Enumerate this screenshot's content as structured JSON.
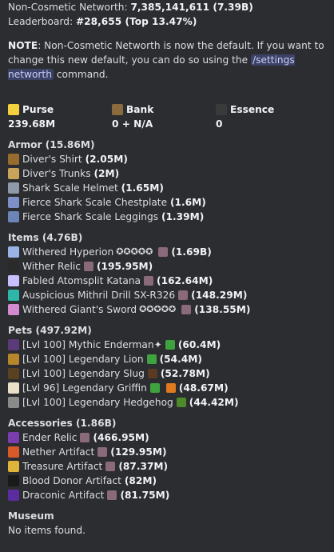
{
  "header": {
    "non_cosmetic_label": "Non-Cosmetic Networth:",
    "non_cosmetic_value": "7,385,141,611 (7.39B)",
    "leaderboard_label": "Leaderboard:",
    "leaderboard_value": "#28,655 (Top 13.47%)"
  },
  "note": {
    "label": "NOTE",
    "text1": ": Non-Cosmetic Networth is now the default. If you want to change this new default, you can do so using the ",
    "command": "/settings networth",
    "text2": " command."
  },
  "summary": [
    {
      "label": "Purse",
      "value": "239.68M",
      "icon": "gold-ingot-icon",
      "color": "#f4d03f"
    },
    {
      "label": "Bank",
      "value": "0 + N/A",
      "icon": "chest-icon",
      "color": "#8b6a3e"
    },
    {
      "label": "Essence",
      "value": "0",
      "icon": "ender-eye-icon",
      "color": "#3a3a3a"
    }
  ],
  "armor": {
    "title": "Armor (15.86M)",
    "items": [
      {
        "name": "Diver's Shirt",
        "value": "(2.05M)",
        "color": "#9a6b2f"
      },
      {
        "name": "Diver's Trunks",
        "value": "(2M)",
        "color": "#c9a35a"
      },
      {
        "name": "Shark Scale Helmet",
        "value": "(1.65M)",
        "color": "#8f9aa8"
      },
      {
        "name": "Fierce Shark Scale Chestplate",
        "value": "(1.6M)",
        "color": "#7d90c8"
      },
      {
        "name": "Fierce Shark Scale Leggings",
        "value": "(1.39M)",
        "color": "#6d84b8"
      }
    ]
  },
  "items_section": {
    "title": "Items (4.76B)",
    "items": [
      {
        "name": "Withered Hyperion",
        "stars": "✪✪✪✪✪",
        "value": "(1.69B)",
        "color": "#9ab3e6",
        "extra": true
      },
      {
        "name": "Wither Relic",
        "stars": "",
        "value": "(195.95M)",
        "color": "#2a2a2a",
        "extra": true
      },
      {
        "name": "Fabled Atomsplit Katana",
        "stars": "",
        "value": "(162.64M)",
        "color": "#c7c0ff",
        "extra": true
      },
      {
        "name": "Auspicious Mithril Drill SX-R326",
        "stars": "",
        "value": "(148.29M)",
        "color": "#2fb6a9",
        "extra": true
      },
      {
        "name": "Withered Giant's Sword",
        "stars": "✪✪✪✪✪",
        "value": "(138.55M)",
        "color": "#d48ad0",
        "extra": true
      }
    ]
  },
  "pets": {
    "title": "Pets (497.92M)",
    "items": [
      {
        "name": "[Lvl 100] Mythic Enderman",
        "suffix": "✦",
        "value": "(60.4M)",
        "color": "#5a3a78",
        "items": [
          "#3ea33e"
        ]
      },
      {
        "name": "[Lvl 100] Legendary Lion",
        "suffix": "",
        "value": "(54.4M)",
        "color": "#b9862c",
        "items": [
          "#3ea33e"
        ]
      },
      {
        "name": "[Lvl 100] Legendary Slug",
        "suffix": "",
        "value": "(52.78M)",
        "color": "#5a4220",
        "items": [
          "#5a3a22"
        ]
      },
      {
        "name": "[Lvl 96] Legendary Griffin",
        "suffix": "",
        "value": "(48.67M)",
        "color": "#e8e0c8",
        "items": [
          "#3ea33e",
          "#e07a1e"
        ]
      },
      {
        "name": "[Lvl 100] Legendary Hedgehog",
        "suffix": "",
        "value": "(44.42M)",
        "color": "#8a8a8a",
        "items": [
          "#4f8a2a"
        ]
      }
    ]
  },
  "accessories": {
    "title": "Accessories (1.86B)",
    "items": [
      {
        "name": "Ender Relic",
        "value": "(466.95M)",
        "color": "#7a3db0",
        "extra": true
      },
      {
        "name": "Nether Artifact",
        "value": "(129.95M)",
        "color": "#d85a2a",
        "extra": true
      },
      {
        "name": "Treasure Artifact",
        "value": "(87.37M)",
        "color": "#e0b33a",
        "extra": true
      },
      {
        "name": "Blood Donor Artifact",
        "value": "(82M)",
        "color": "#1a1a1a",
        "extra": false
      },
      {
        "name": "Draconic Artifact",
        "value": "(81.75M)",
        "color": "#5a2ca0",
        "extra": true
      }
    ]
  },
  "museum": {
    "title": "Museum",
    "text": "No items found."
  },
  "colors": {
    "background": "#2b2d31",
    "text": "#dbdee1",
    "command_bg": "#3b4266",
    "enchant_badge": "#8a6a7a"
  }
}
